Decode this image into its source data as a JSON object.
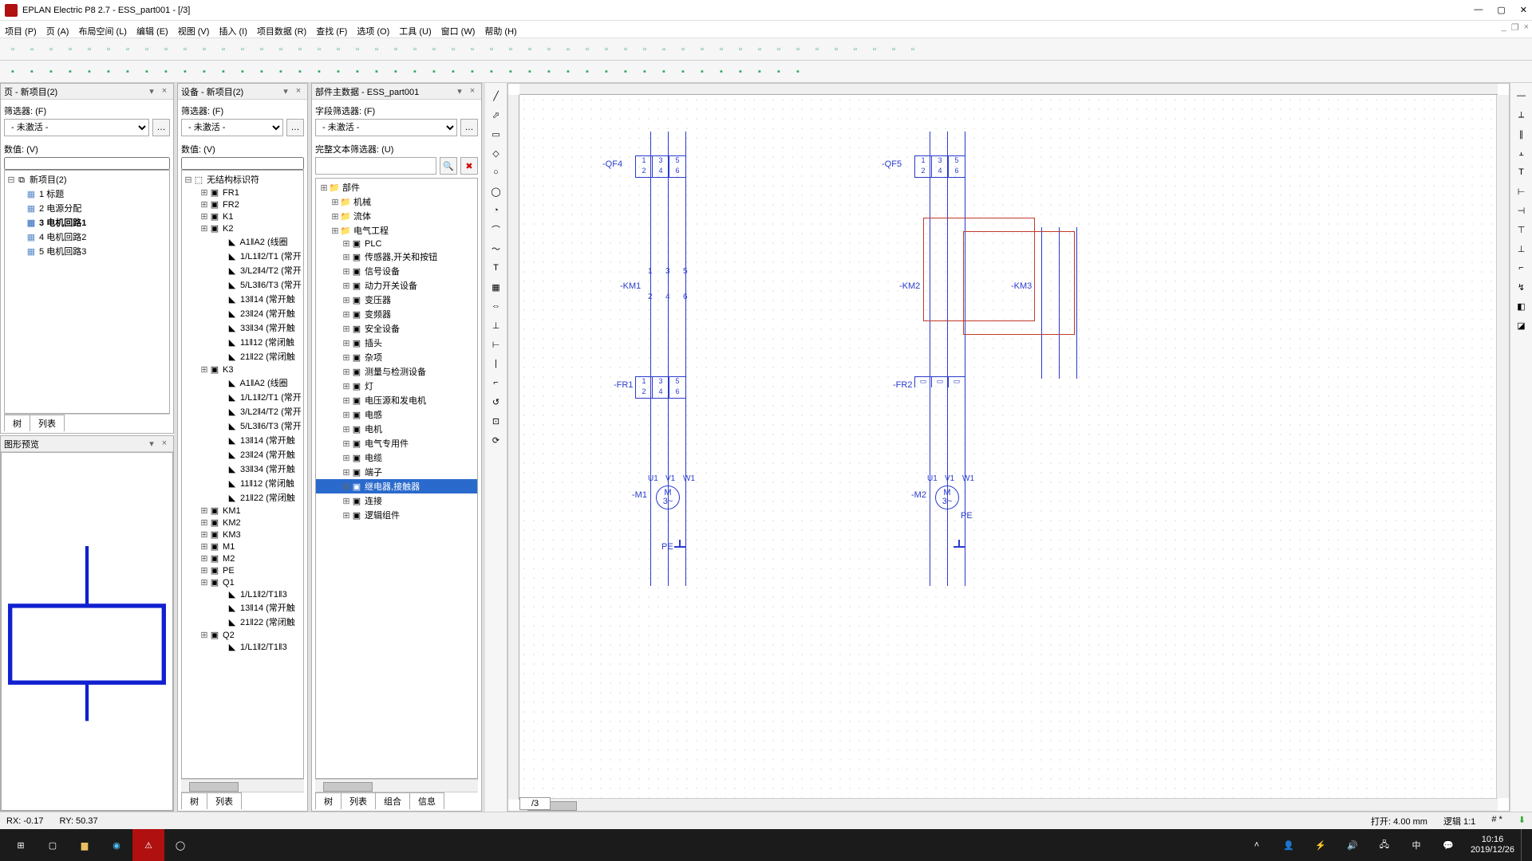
{
  "title": "EPLAN Electric P8 2.7 - ESS_part001 - [/3]",
  "menu": [
    "项目 (P)",
    "页 (A)",
    "布局空间 (L)",
    "编辑 (E)",
    "视图 (V)",
    "插入 (I)",
    "项目数据 (R)",
    "查找 (F)",
    "选项 (O)",
    "工具 (U)",
    "窗口 (W)",
    "帮助 (H)"
  ],
  "panels": {
    "pages": {
      "title": "页 - 新项目(2)",
      "filter_lbl": "筛选器: (F)",
      "filter_val": "- 未激活 -",
      "value_lbl": "数值: (V)",
      "root": "新项目(2)",
      "items": [
        {
          "n": "1 标题"
        },
        {
          "n": "2 电源分配"
        },
        {
          "n": "3 电机回路1",
          "sel": true
        },
        {
          "n": "4 电机回路2"
        },
        {
          "n": "5 电机回路3"
        }
      ],
      "tabs": [
        "树",
        "列表"
      ]
    },
    "preview": {
      "title": "图形预览"
    },
    "devices": {
      "title": "设备 - 新项目(2)",
      "filter_lbl": "筛选器: (F)",
      "filter_val": "- 未激活 -",
      "value_lbl": "数值: (V)",
      "root": "无结构标识符",
      "items": [
        "FR1",
        "FR2",
        "K1",
        "K2",
        "　A1¶A2 (线圈",
        "　1/L1¶2/T1 (常开",
        "　3/L2¶4/T2 (常开",
        "　5/L3¶6/T3 (常开",
        "　13¶14 (常开触",
        "　23¶24 (常开触",
        "　33¶34 (常开触",
        "　11¶12 (常闭触",
        "　21¶22 (常闭触",
        "K3",
        "　A1¶A2 (线圈",
        "　1/L1¶2/T1 (常开",
        "　3/L2¶4/T2 (常开",
        "　5/L3¶6/T3 (常开",
        "　13¶14 (常开触",
        "　23¶24 (常开触",
        "　33¶34 (常开触",
        "　11¶12 (常闭触",
        "　21¶22 (常闭触",
        "KM1",
        "KM2",
        "KM3",
        "M1",
        "M2",
        "PE",
        "Q1",
        "　1/L1¶2/T1¶3",
        "　13¶14 (常开触",
        "　21¶22 (常闭触",
        "Q2",
        "　1/L1¶2/T1¶3"
      ],
      "tabs": [
        "树",
        "列表"
      ]
    },
    "parts": {
      "title": "部件主数据 - ESS_part001",
      "field_filter_lbl": "字段筛选器: (F)",
      "field_filter_val": "- 未激活 -",
      "text_filter_lbl": "完整文本筛选器: (U)",
      "tree": [
        {
          "t": "部件",
          "d": 0,
          "f": true
        },
        {
          "t": "机械",
          "d": 1,
          "f": true
        },
        {
          "t": "流体",
          "d": 1,
          "f": true
        },
        {
          "t": "电气工程",
          "d": 1,
          "f": true,
          "open": true
        },
        {
          "t": "PLC",
          "d": 2
        },
        {
          "t": "传感器,开关和按钮",
          "d": 2
        },
        {
          "t": "信号设备",
          "d": 2
        },
        {
          "t": "动力开关设备",
          "d": 2
        },
        {
          "t": "变压器",
          "d": 2
        },
        {
          "t": "变频器",
          "d": 2
        },
        {
          "t": "安全设备",
          "d": 2
        },
        {
          "t": "插头",
          "d": 2
        },
        {
          "t": "杂项",
          "d": 2
        },
        {
          "t": "测量与检测设备",
          "d": 2
        },
        {
          "t": "灯",
          "d": 2
        },
        {
          "t": "电压源和发电机",
          "d": 2
        },
        {
          "t": "电感",
          "d": 2
        },
        {
          "t": "电机",
          "d": 2
        },
        {
          "t": "电气专用件",
          "d": 2
        },
        {
          "t": "电缆",
          "d": 2
        },
        {
          "t": "端子",
          "d": 2
        },
        {
          "t": "继电器,接触器",
          "d": 2,
          "hi": true
        },
        {
          "t": "连接",
          "d": 2
        },
        {
          "t": "逻辑组件",
          "d": 2
        }
      ],
      "tabs": [
        "树",
        "列表",
        "组合",
        "信息"
      ]
    }
  },
  "schematic": {
    "labels": {
      "qf4": "-QF4",
      "qf5": "-QF5",
      "km1": "-KM1",
      "km2": "-KM2",
      "km3": "-KM3",
      "fr1": "-FR1",
      "fr2": "-FR2",
      "m1": "-M1",
      "m2": "-M2",
      "pe": "PE",
      "pe2": "PE"
    },
    "terminals_top": [
      "1",
      "3",
      "5"
    ],
    "terminals_bot": [
      "2",
      "4",
      "6"
    ],
    "motor_terms": [
      "U1",
      "V1",
      "W1"
    ]
  },
  "status": {
    "rx": "RX: -0.17",
    "ry": "RY: 50.37",
    "grid": "打开: 4.00 mm",
    "zoom": "逻辑 1:1",
    "mark": "# *"
  },
  "page_tab": "/3",
  "clock": {
    "time": "10:16",
    "date": "2019/12/26"
  }
}
